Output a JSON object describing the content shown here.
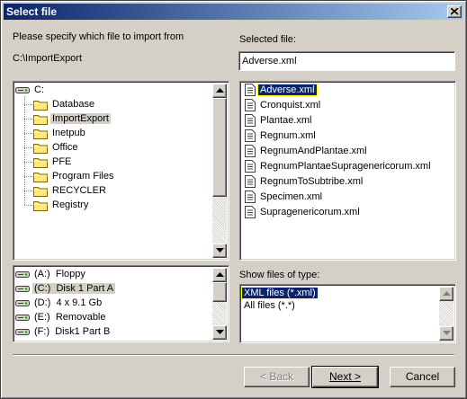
{
  "window": {
    "title": "Select file"
  },
  "prompt": "Please specify which file to import from",
  "current_path": "C:\\ImportExport",
  "selected_file_label": "Selected file:",
  "selected_file_value": "Adverse.xml",
  "folder_tree": {
    "root": "C:",
    "items": [
      {
        "label": "Database",
        "selected": false
      },
      {
        "label": "ImportExport",
        "selected": true
      },
      {
        "label": "Inetpub",
        "selected": false
      },
      {
        "label": "Office",
        "selected": false
      },
      {
        "label": "PFE",
        "selected": false
      },
      {
        "label": "Program Files",
        "selected": false
      },
      {
        "label": "RECYCLER",
        "selected": false
      },
      {
        "label": "Registry",
        "selected": false
      }
    ]
  },
  "drives": [
    {
      "letter": "(A:)",
      "name": "Floppy",
      "selected": false
    },
    {
      "letter": "(C:)",
      "name": "Disk 1 Part A",
      "selected": true
    },
    {
      "letter": "(D:)",
      "name": "4 x 9.1 Gb",
      "selected": false
    },
    {
      "letter": "(E:)",
      "name": "Removable",
      "selected": false
    },
    {
      "letter": "(F:)",
      "name": "Disk1 Part B",
      "selected": false
    }
  ],
  "files": [
    {
      "label": "Adverse.xml",
      "selected": true
    },
    {
      "label": "Cronquist.xml",
      "selected": false
    },
    {
      "label": "Plantae.xml",
      "selected": false
    },
    {
      "label": "Regnum.xml",
      "selected": false
    },
    {
      "label": "RegnumAndPlantae.xml",
      "selected": false
    },
    {
      "label": "RegnumPlantaeSupragenericorum.xml",
      "selected": false
    },
    {
      "label": "RegnumToSubtribe.xml",
      "selected": false
    },
    {
      "label": "Specimen.xml",
      "selected": false
    },
    {
      "label": "Supragenericorum.xml",
      "selected": false
    }
  ],
  "file_types_label": "Show files of type:",
  "file_types": [
    {
      "label": "XML files (*.xml)",
      "selected": true
    },
    {
      "label": "All files (*.*)",
      "selected": false
    }
  ],
  "buttons": {
    "back": "< Back",
    "next": "Next >",
    "cancel": "Cancel"
  },
  "icons": {
    "close": "close-icon",
    "folder": "folder-icon",
    "drive": "drive-icon",
    "file": "document-icon"
  },
  "colors": {
    "titlebar_start": "#0a246a",
    "titlebar_end": "#a6caf0",
    "selection": "#0a246a",
    "face": "#d4d0c8"
  }
}
